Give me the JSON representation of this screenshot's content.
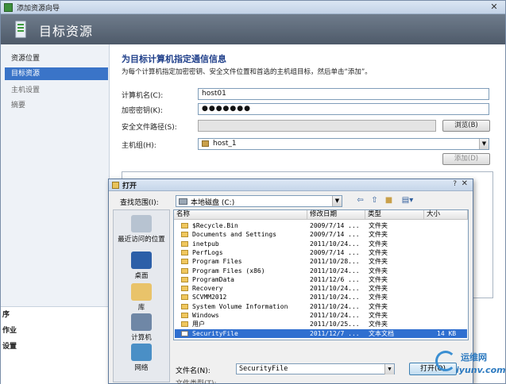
{
  "window": {
    "title": "添加资源向导",
    "close_glyph": "✕",
    "header_title": "目标资源"
  },
  "nav": {
    "items": [
      {
        "label": "资源位置",
        "state": "normal"
      },
      {
        "label": "目标资源",
        "state": "active"
      },
      {
        "label": "主机设置",
        "state": "dim"
      },
      {
        "label": "摘要",
        "state": "dim"
      }
    ]
  },
  "form": {
    "heading": "为目标计算机指定通信信息",
    "description": "为每个计算机指定加密密钥、安全文件位置和首选的主机组目标，然后单击“添加”。",
    "computer_name_label": "计算机名(C):",
    "computer_name_value": "host01",
    "encryption_key_label": "加密密钥(K):",
    "encryption_key_value": "●●●●●●●",
    "security_path_label": "安全文件路径(S):",
    "security_path_value": "",
    "browse_label": "浏览(B)",
    "host_group_label": "主机组(H):",
    "host_group_value": "host_1",
    "add_label": "添加(D)"
  },
  "left_panel": {
    "items": [
      "序",
      "作业",
      "设置"
    ]
  },
  "open_dialog": {
    "title": "打开",
    "help_glyph": "?",
    "close_glyph": "✕",
    "look_in_label": "查找范围(I):",
    "look_in_value": "本地磁盘 (C:)",
    "places": [
      "最近访问的位置",
      "桌面",
      "库",
      "计算机",
      "网络"
    ],
    "columns": [
      "名称",
      "修改日期",
      "类型",
      "大小"
    ],
    "files": [
      {
        "name": "$Recycle.Bin",
        "date": "2009/7/14 ...",
        "type": "文件夹",
        "size": "",
        "kind": "folder"
      },
      {
        "name": "Documents and Settings",
        "date": "2009/7/14 ...",
        "type": "文件夹",
        "size": "",
        "kind": "folder"
      },
      {
        "name": "inetpub",
        "date": "2011/10/24...",
        "type": "文件夹",
        "size": "",
        "kind": "folder"
      },
      {
        "name": "PerfLogs",
        "date": "2009/7/14 ...",
        "type": "文件夹",
        "size": "",
        "kind": "folder"
      },
      {
        "name": "Program Files",
        "date": "2011/10/28...",
        "type": "文件夹",
        "size": "",
        "kind": "folder"
      },
      {
        "name": "Program Files (x86)",
        "date": "2011/10/24...",
        "type": "文件夹",
        "size": "",
        "kind": "folder"
      },
      {
        "name": "ProgramData",
        "date": "2011/12/6 ...",
        "type": "文件夹",
        "size": "",
        "kind": "folder"
      },
      {
        "name": "Recovery",
        "date": "2011/10/24...",
        "type": "文件夹",
        "size": "",
        "kind": "folder"
      },
      {
        "name": "SCVMM2012",
        "date": "2011/10/24...",
        "type": "文件夹",
        "size": "",
        "kind": "folder"
      },
      {
        "name": "System Volume Information",
        "date": "2011/10/24...",
        "type": "文件夹",
        "size": "",
        "kind": "folder"
      },
      {
        "name": "Windows",
        "date": "2011/10/24...",
        "type": "文件夹",
        "size": "",
        "kind": "folder"
      },
      {
        "name": "用户",
        "date": "2011/10/25...",
        "type": "文件夹",
        "size": "",
        "kind": "folder"
      },
      {
        "name": "SecurityFile",
        "date": "2011/12/7 ...",
        "type": "文本文档",
        "size": "14 KB",
        "kind": "file",
        "selected": true
      }
    ],
    "file_name_label": "文件名(N):",
    "file_name_value": "SecurityFile",
    "open_label": "打开(O)",
    "file_type_label": "文件类型(T):"
  },
  "watermark": {
    "line1": "运维网",
    "line2": "iyunv.com"
  }
}
